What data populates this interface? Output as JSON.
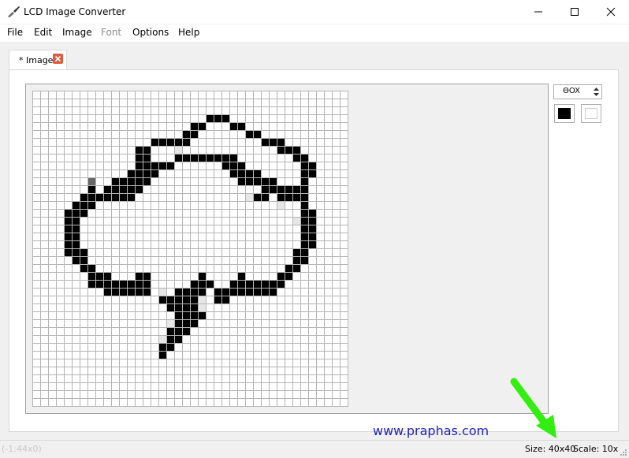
{
  "window": {
    "title": "LCD Image Converter",
    "icon": "brush-icon"
  },
  "menu": [
    "File",
    "Edit",
    "Image",
    "Font",
    "Options",
    "Help"
  ],
  "menu_disabled": [
    "Font"
  ],
  "tab": {
    "label": "* Image",
    "close_icon": "close-icon"
  },
  "toolbox": {
    "scale_value": "ΘOX",
    "fore_color": "#000000",
    "back_color": "#ffffff"
  },
  "status": {
    "size": "Size: 40x40",
    "scale": "Scale: 10x",
    "coords": "(-1:44x0)"
  },
  "watermark": "www.praphas.com",
  "annotation_arrow_color": "#33ee11",
  "grid": {
    "columns": 40,
    "rows": 40
  },
  "pixels": {
    "black": [
      [
        22,
        3
      ],
      [
        23,
        3
      ],
      [
        24,
        3
      ],
      [
        20,
        4
      ],
      [
        21,
        4
      ],
      [
        25,
        4
      ],
      [
        26,
        4
      ],
      [
        19,
        5
      ],
      [
        20,
        5
      ],
      [
        27,
        5
      ],
      [
        28,
        5
      ],
      [
        15,
        6
      ],
      [
        16,
        6
      ],
      [
        17,
        6
      ],
      [
        18,
        6
      ],
      [
        19,
        6
      ],
      [
        29,
        6
      ],
      [
        30,
        6
      ],
      [
        31,
        6
      ],
      [
        13,
        7
      ],
      [
        14,
        7
      ],
      [
        31,
        7
      ],
      [
        32,
        7
      ],
      [
        33,
        7
      ],
      [
        13,
        8
      ],
      [
        14,
        8
      ],
      [
        18,
        8
      ],
      [
        19,
        8
      ],
      [
        20,
        8
      ],
      [
        21,
        8
      ],
      [
        22,
        8
      ],
      [
        23,
        8
      ],
      [
        24,
        8
      ],
      [
        25,
        8
      ],
      [
        33,
        8
      ],
      [
        34,
        8
      ],
      [
        13,
        9
      ],
      [
        14,
        9
      ],
      [
        15,
        9
      ],
      [
        16,
        9
      ],
      [
        17,
        9
      ],
      [
        24,
        9
      ],
      [
        25,
        9
      ],
      [
        26,
        9
      ],
      [
        34,
        9
      ],
      [
        35,
        9
      ],
      [
        12,
        10
      ],
      [
        13,
        10
      ],
      [
        14,
        10
      ],
      [
        15,
        10
      ],
      [
        25,
        10
      ],
      [
        26,
        10
      ],
      [
        27,
        10
      ],
      [
        28,
        10
      ],
      [
        34,
        10
      ],
      [
        35,
        10
      ],
      [
        10,
        11
      ],
      [
        11,
        11
      ],
      [
        12,
        11
      ],
      [
        13,
        11
      ],
      [
        14,
        11
      ],
      [
        26,
        11
      ],
      [
        27,
        11
      ],
      [
        28,
        11
      ],
      [
        29,
        11
      ],
      [
        30,
        11
      ],
      [
        34,
        11
      ],
      [
        7,
        12
      ],
      [
        9,
        12
      ],
      [
        10,
        11
      ],
      [
        10,
        12
      ],
      [
        11,
        12
      ],
      [
        12,
        12
      ],
      [
        13,
        12
      ],
      [
        29,
        12
      ],
      [
        30,
        12
      ],
      [
        31,
        12
      ],
      [
        32,
        12
      ],
      [
        33,
        12
      ],
      [
        34,
        12
      ],
      [
        6,
        13
      ],
      [
        7,
        13
      ],
      [
        8,
        13
      ],
      [
        9,
        13
      ],
      [
        10,
        13
      ],
      [
        11,
        13
      ],
      [
        12,
        13
      ],
      [
        28,
        13
      ],
      [
        29,
        13
      ],
      [
        31,
        13
      ],
      [
        32,
        13
      ],
      [
        33,
        13
      ],
      [
        34,
        13
      ],
      [
        5,
        14
      ],
      [
        6,
        14
      ],
      [
        7,
        14
      ],
      [
        34,
        14
      ],
      [
        4,
        15
      ],
      [
        5,
        15
      ],
      [
        6,
        15
      ],
      [
        34,
        15
      ],
      [
        35,
        15
      ],
      [
        4,
        16
      ],
      [
        5,
        16
      ],
      [
        34,
        16
      ],
      [
        35,
        16
      ],
      [
        4,
        17
      ],
      [
        5,
        17
      ],
      [
        34,
        17
      ],
      [
        35,
        17
      ],
      [
        4,
        18
      ],
      [
        5,
        18
      ],
      [
        34,
        18
      ],
      [
        35,
        18
      ],
      [
        4,
        19
      ],
      [
        5,
        19
      ],
      [
        34,
        19
      ],
      [
        35,
        19
      ],
      [
        4,
        20
      ],
      [
        5,
        20
      ],
      [
        6,
        20
      ],
      [
        33,
        20
      ],
      [
        34,
        20
      ],
      [
        5,
        21
      ],
      [
        6,
        21
      ],
      [
        33,
        21
      ],
      [
        34,
        21
      ],
      [
        6,
        22
      ],
      [
        7,
        22
      ],
      [
        32,
        22
      ],
      [
        33,
        22
      ],
      [
        7,
        23
      ],
      [
        8,
        23
      ],
      [
        9,
        23
      ],
      [
        13,
        23
      ],
      [
        14,
        23
      ],
      [
        21,
        23
      ],
      [
        26,
        23
      ],
      [
        31,
        23
      ],
      [
        32,
        23
      ],
      [
        7,
        24
      ],
      [
        8,
        24
      ],
      [
        9,
        24
      ],
      [
        10,
        24
      ],
      [
        11,
        24
      ],
      [
        12,
        24
      ],
      [
        13,
        24
      ],
      [
        14,
        24
      ],
      [
        20,
        24
      ],
      [
        21,
        24
      ],
      [
        22,
        24
      ],
      [
        25,
        24
      ],
      [
        26,
        24
      ],
      [
        27,
        24
      ],
      [
        28,
        24
      ],
      [
        29,
        24
      ],
      [
        30,
        24
      ],
      [
        31,
        24
      ],
      [
        9,
        25
      ],
      [
        10,
        25
      ],
      [
        11,
        25
      ],
      [
        12,
        25
      ],
      [
        13,
        25
      ],
      [
        14,
        25
      ],
      [
        18,
        25
      ],
      [
        19,
        25
      ],
      [
        20,
        25
      ],
      [
        21,
        25
      ],
      [
        23,
        25
      ],
      [
        24,
        25
      ],
      [
        25,
        25
      ],
      [
        26,
        25
      ],
      [
        27,
        25
      ],
      [
        28,
        25
      ],
      [
        29,
        25
      ],
      [
        30,
        25
      ],
      [
        16,
        26
      ],
      [
        17,
        26
      ],
      [
        18,
        26
      ],
      [
        19,
        26
      ],
      [
        20,
        26
      ],
      [
        23,
        26
      ],
      [
        24,
        26
      ],
      [
        17,
        27
      ],
      [
        18,
        27
      ],
      [
        19,
        27
      ],
      [
        20,
        27
      ],
      [
        18,
        28
      ],
      [
        19,
        28
      ],
      [
        20,
        28
      ],
      [
        21,
        28
      ],
      [
        18,
        29
      ],
      [
        19,
        29
      ],
      [
        20,
        29
      ],
      [
        17,
        30
      ],
      [
        18,
        30
      ],
      [
        19,
        30
      ],
      [
        17,
        31
      ],
      [
        18,
        31
      ],
      [
        16,
        32
      ],
      [
        17,
        32
      ],
      [
        16,
        33
      ]
    ],
    "gray": [
      [
        7,
        11
      ]
    ],
    "light": [
      [
        18,
        7
      ],
      [
        27,
        13
      ],
      [
        31,
        14
      ],
      [
        33,
        16
      ],
      [
        16,
        25
      ],
      [
        21,
        26
      ],
      [
        17,
        29
      ],
      [
        16,
        31
      ],
      [
        21,
        27
      ]
    ]
  }
}
